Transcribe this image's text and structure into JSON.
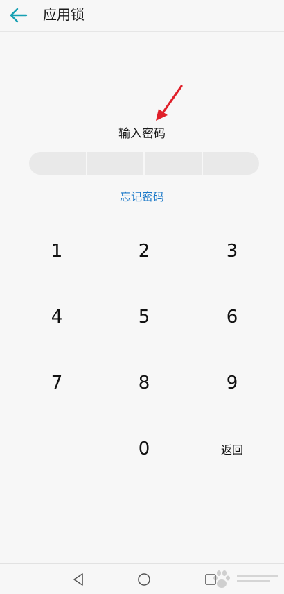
{
  "header": {
    "back_icon": "arrow-left-icon",
    "title": "应用锁",
    "accent_color": "#17a0b3"
  },
  "annotation": {
    "arrow_icon": "red-arrow-icon",
    "color": "#e0202a"
  },
  "lock": {
    "prompt": "输入密码",
    "pin_length": 4,
    "forgot_label": "忘记密码",
    "forgot_color": "#1a78c8"
  },
  "keypad": {
    "keys": [
      {
        "label": "1"
      },
      {
        "label": "2"
      },
      {
        "label": "3"
      },
      {
        "label": "4"
      },
      {
        "label": "5"
      },
      {
        "label": "6"
      },
      {
        "label": "7"
      },
      {
        "label": "8"
      },
      {
        "label": "9"
      },
      {
        "label": "0"
      },
      {
        "label": "返回"
      }
    ]
  },
  "navbar": {
    "back_icon": "triangle-back-icon",
    "home_icon": "circle-home-icon",
    "recents_icon": "square-recents-icon"
  },
  "watermark": {
    "icon": "baidu-paw-watermark"
  }
}
